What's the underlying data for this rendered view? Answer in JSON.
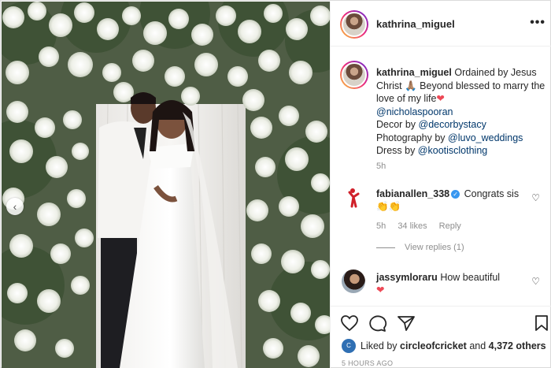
{
  "post": {
    "author": "kathrina_miguel",
    "more_icon": "more-horizontal-icon"
  },
  "caption": {
    "username": "kathrina_miguel",
    "line1": "Ordained by Jesus Christ 🙏🏽 Beyond blessed to marry the love of my life",
    "heart": "❤",
    "mention1": "@nicholaspooran",
    "decor_prefix": "Decor by ",
    "decor_link": "@decorbystacy",
    "photo_prefix": "Photography by ",
    "photo_link": "@luvo_weddings",
    "dress_prefix": "Dress by ",
    "dress_link": "@kootisclothing",
    "time": "5h"
  },
  "comments": [
    {
      "username": "fabianallen_338",
      "text": "Congrats sis",
      "emoji": "👏👏",
      "time": "5h",
      "likes": "34 likes",
      "reply": "Reply",
      "view_replies": "View replies (1)"
    },
    {
      "username": "jassymloraru",
      "text": "How beautiful",
      "emoji": "❤"
    }
  ],
  "footer": {
    "liked_prefix": "Liked by ",
    "liked_user": "circleofcricket",
    "liked_and": " and ",
    "liked_count": "4,372 others",
    "timestamp": "5 HOURS AGO"
  },
  "colors": {
    "link": "#00376b",
    "muted": "#8e8e8e",
    "verified": "#3897f0"
  }
}
